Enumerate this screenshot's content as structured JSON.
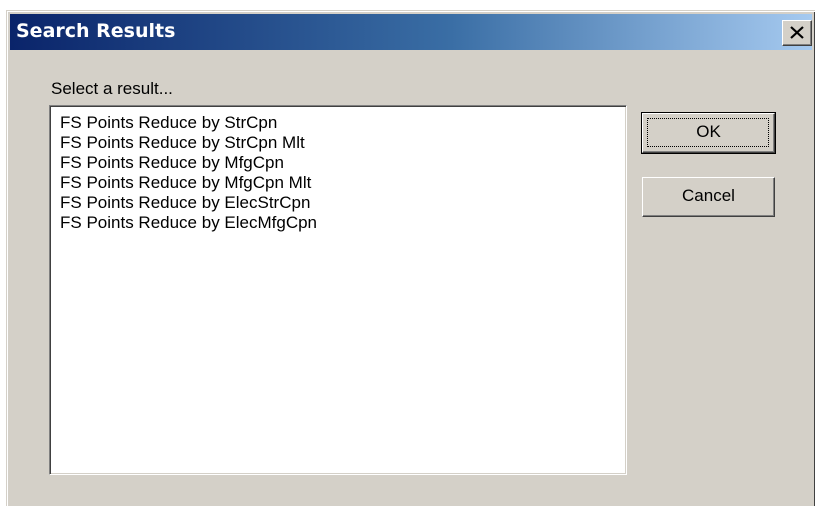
{
  "window": {
    "title": "Search Results"
  },
  "dialog": {
    "prompt": "Select a result...",
    "results": [
      "FS Points Reduce by StrCpn",
      "FS Points Reduce by StrCpn Mlt",
      "FS Points Reduce by MfgCpn",
      "FS Points Reduce by MfgCpn Mlt",
      "FS Points Reduce by ElecStrCpn",
      "FS Points Reduce by ElecMfgCpn"
    ],
    "ok_label": "OK",
    "cancel_label": "Cancel"
  },
  "icons": {
    "close": "close-icon"
  },
  "colors": {
    "title_gradient_start": "#0a246a",
    "title_gradient_end": "#a6caf0",
    "dialog_face": "#d4d0c8",
    "list_background": "#ffffff"
  }
}
